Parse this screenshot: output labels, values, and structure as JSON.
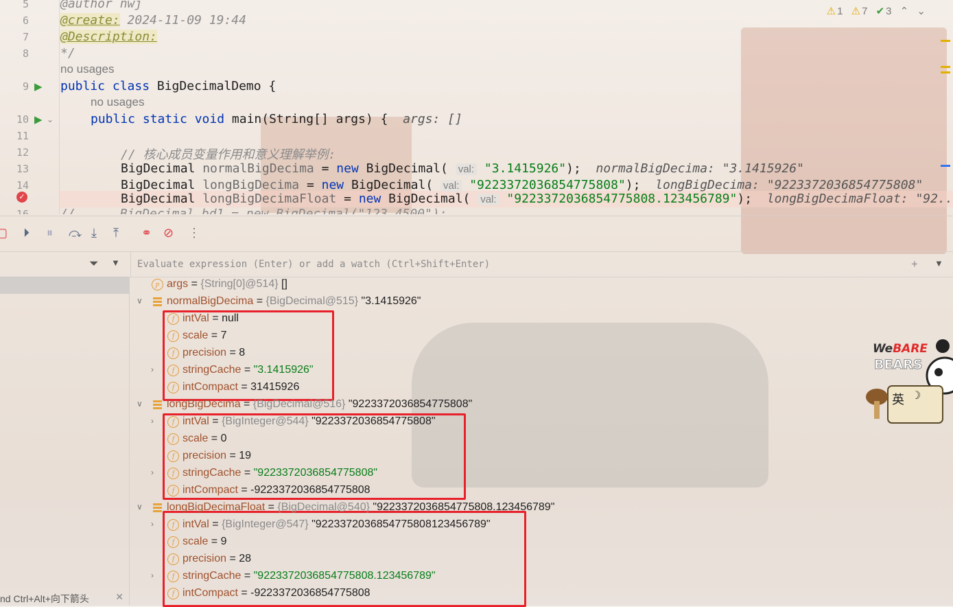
{
  "editor": {
    "lines": [
      {
        "num": "5",
        "text": "@author nwj"
      },
      {
        "num": "6",
        "tag": "@create:",
        "rest": " 2024-11-09 19:44"
      },
      {
        "num": "7",
        "tag": "@Description:"
      },
      {
        "num": "8",
        "text": "*/"
      },
      {
        "usages": "no usages"
      },
      {
        "num": "9",
        "kw1": "public class",
        "rest": " BigDecimalDemo {"
      },
      {
        "usages": "no usages"
      },
      {
        "num": "10",
        "kw1": "public static void",
        "rest": " main(String[] args) {",
        "inline": "args: []"
      },
      {
        "num": "11"
      },
      {
        "num": "12",
        "comment": "// 核心成员变量作用和意义理解举例:"
      },
      {
        "num": "13",
        "type": "BigDecimal",
        "var": "normalBigDecima",
        "eq": " = ",
        "kw": "new",
        "ctor": " BigDecimal(",
        "hint": "val:",
        "str": "\"3.1415926\"",
        "end": ");",
        "inline": "normalBigDecima: \"3.1415926\""
      },
      {
        "num": "14",
        "type": "BigDecimal",
        "var": "longBigDecima",
        "eq": " = ",
        "kw": "new",
        "ctor": " BigDecimal(",
        "hint": "val:",
        "str": "\"9223372036854775808\"",
        "end": ");",
        "inline": "longBigDecima: \"9223372036854775808\""
      },
      {
        "num": "",
        "type": "BigDecimal",
        "var": "longBigDecimaFloat",
        "eq": " = ",
        "kw": "new",
        "ctor": " BigDecimal(",
        "hint": "val:",
        "str": "\"9223372036854775808.123456789\"",
        "end": ");",
        "inline": "longBigDecimaFloat: \"92..."
      },
      {
        "num": "16",
        "text": "//      BigDecimal bd1 = new BigDecimal(\"123.4500\");"
      }
    ],
    "inspections": {
      "weak_warnings": "1",
      "warnings": "7",
      "ok": "3"
    }
  },
  "watch": {
    "placeholder": "Evaluate expression (Enter) or add a watch (Ctrl+Shift+Enter)"
  },
  "frames": {
    "status": "nd Ctrl+Alt+向下箭头"
  },
  "variables": [
    {
      "indent": 0,
      "icon": "p",
      "name": "args",
      "eq": " = ",
      "type": "{String[0]@514}",
      "value": " []"
    },
    {
      "indent": 0,
      "icon": "local",
      "expanded": true,
      "name": "normalBigDecima",
      "eq": " = ",
      "type": "{BigDecimal@515}",
      "value": " \"3.1415926\""
    },
    {
      "indent": 1,
      "icon": "f",
      "name": "intVal",
      "eq": " = ",
      "value": "null"
    },
    {
      "indent": 1,
      "icon": "f",
      "name": "scale",
      "eq": " = ",
      "value": "7"
    },
    {
      "indent": 1,
      "icon": "f",
      "name": "precision",
      "eq": " = ",
      "value": "8"
    },
    {
      "indent": 1,
      "icon": "f",
      "collapsed": true,
      "name": "stringCache",
      "eq": " = ",
      "str": "\"3.1415926\""
    },
    {
      "indent": 1,
      "icon": "f",
      "name": "intCompact",
      "eq": " = ",
      "value": "31415926"
    },
    {
      "indent": 0,
      "icon": "local",
      "expanded": true,
      "name": "longBigDecima",
      "eq": " = ",
      "type": "{BigDecimal@516}",
      "value": " \"9223372036854775808\""
    },
    {
      "indent": 1,
      "icon": "f",
      "collapsed": true,
      "name": "intVal",
      "eq": " = ",
      "type": "{BigInteger@544}",
      "value": " \"9223372036854775808\""
    },
    {
      "indent": 1,
      "icon": "f",
      "name": "scale",
      "eq": " = ",
      "value": "0"
    },
    {
      "indent": 1,
      "icon": "f",
      "name": "precision",
      "eq": " = ",
      "value": "19"
    },
    {
      "indent": 1,
      "icon": "f",
      "collapsed": true,
      "name": "stringCache",
      "eq": " = ",
      "str": "\"9223372036854775808\""
    },
    {
      "indent": 1,
      "icon": "f",
      "name": "intCompact",
      "eq": " = ",
      "value": "-9223372036854775808"
    },
    {
      "indent": 0,
      "icon": "local",
      "expanded": true,
      "name": "longBigDecimaFloat",
      "eq": " = ",
      "type": "{BigDecimal@540}",
      "value": " \"9223372036854775808.123456789\""
    },
    {
      "indent": 1,
      "icon": "f",
      "collapsed": true,
      "name": "intVal",
      "eq": " = ",
      "type": "{BigInteger@547}",
      "value": " \"9223372036854775808123456789\""
    },
    {
      "indent": 1,
      "icon": "f",
      "name": "scale",
      "eq": " = ",
      "value": "9"
    },
    {
      "indent": 1,
      "icon": "f",
      "name": "precision",
      "eq": " = ",
      "value": "28"
    },
    {
      "indent": 1,
      "icon": "f",
      "collapsed": true,
      "name": "stringCache",
      "eq": " = ",
      "str": "\"9223372036854775808.123456789\""
    },
    {
      "indent": 1,
      "icon": "f",
      "name": "intCompact",
      "eq": " = ",
      "value": "-9223372036854775808"
    }
  ],
  "sticker": {
    "brand_top": "We",
    "brand_main": "BARE",
    "brand_sub": "BEARS",
    "ime": "英"
  },
  "colors": {
    "keyword": "#0033b3",
    "string": "#067d17",
    "highlight_box": "#e8202a",
    "field_icon": "#e39b3c"
  }
}
